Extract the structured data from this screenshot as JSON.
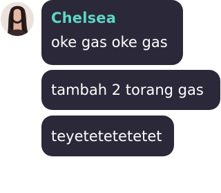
{
  "chat": {
    "sender_name": "Chelsea",
    "avatar_icon": "user-avatar-icon",
    "messages": [
      {
        "text": "oke gas oke gas"
      },
      {
        "text": "tambah 2 torang gas"
      },
      {
        "text": "teyetetetetetet"
      }
    ]
  },
  "colors": {
    "bubble_background": "#2b2839",
    "sender_name": "#5dd6c4",
    "message_text": "#ffffff"
  }
}
